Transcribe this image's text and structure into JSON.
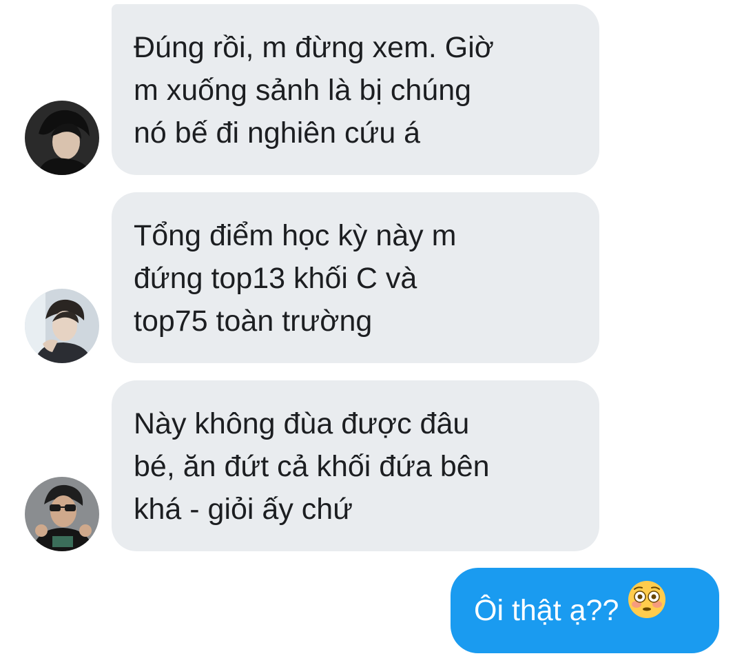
{
  "messages": [
    {
      "direction": "incoming",
      "lines": [
        "Đúng rồi, m đừng xem. Giờ",
        "m xuống sảnh là bị chúng",
        "nó bế đi nghiên cứu á"
      ]
    },
    {
      "direction": "incoming",
      "lines": [
        "Tổng điểm học kỳ này m",
        "đứng top13 khối C và",
        "top75 toàn trường"
      ]
    },
    {
      "direction": "incoming",
      "lines": [
        "Này không đùa được đâu",
        "bé, ăn đứt cả khối đứa bên",
        "khá - giỏi ấy chứ"
      ]
    },
    {
      "direction": "outgoing",
      "text": "Ôi thật ạ??",
      "emoji": "flushed-face-icon"
    }
  ],
  "colors": {
    "incoming_bubble": "#e9ecef",
    "outgoing_bubble": "#1a9bf0",
    "incoming_text": "#1c1e21",
    "outgoing_text": "#ffffff"
  }
}
